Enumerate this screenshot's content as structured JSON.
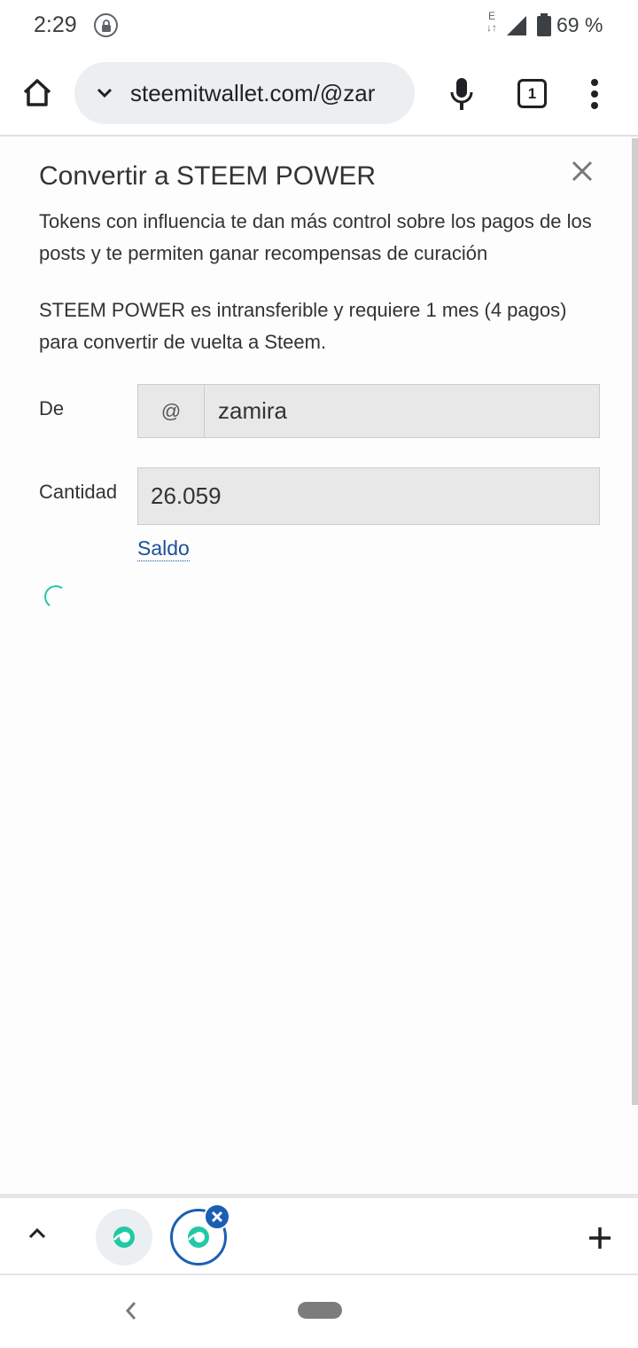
{
  "status_bar": {
    "time": "2:29",
    "data_indicator": "E",
    "battery": "69 %"
  },
  "browser": {
    "url": "steemitwallet.com/@zar",
    "tab_count": "1"
  },
  "dialog": {
    "title": "Convertir a STEEM POWER",
    "description_1": "Tokens con influencia te dan más control sobre los pagos de los posts y te permiten ganar recompensas de curación",
    "description_2": "STEEM POWER es intransferible y requiere 1 mes (4 pagos) para convertir de vuelta a Steem.",
    "from_label": "De",
    "from_prefix": "@",
    "from_value": "zamira",
    "amount_label": "Cantidad",
    "amount_value": "26.059",
    "balance_link": "Saldo"
  },
  "colors": {
    "accent_teal": "#21c9a6",
    "link_blue": "#1a5099",
    "tab_active": "#1a5fb4"
  },
  "icons": {
    "home": "home-icon",
    "url_chevron": "chevron-down-icon",
    "mic": "microphone-icon",
    "menu": "more-vert-icon",
    "close": "close-icon",
    "tab_favicon": "steemit-logo-icon",
    "new_tab": "plus-icon",
    "tabstrip_expand": "chevron-up-icon",
    "nav_back": "back-icon"
  }
}
